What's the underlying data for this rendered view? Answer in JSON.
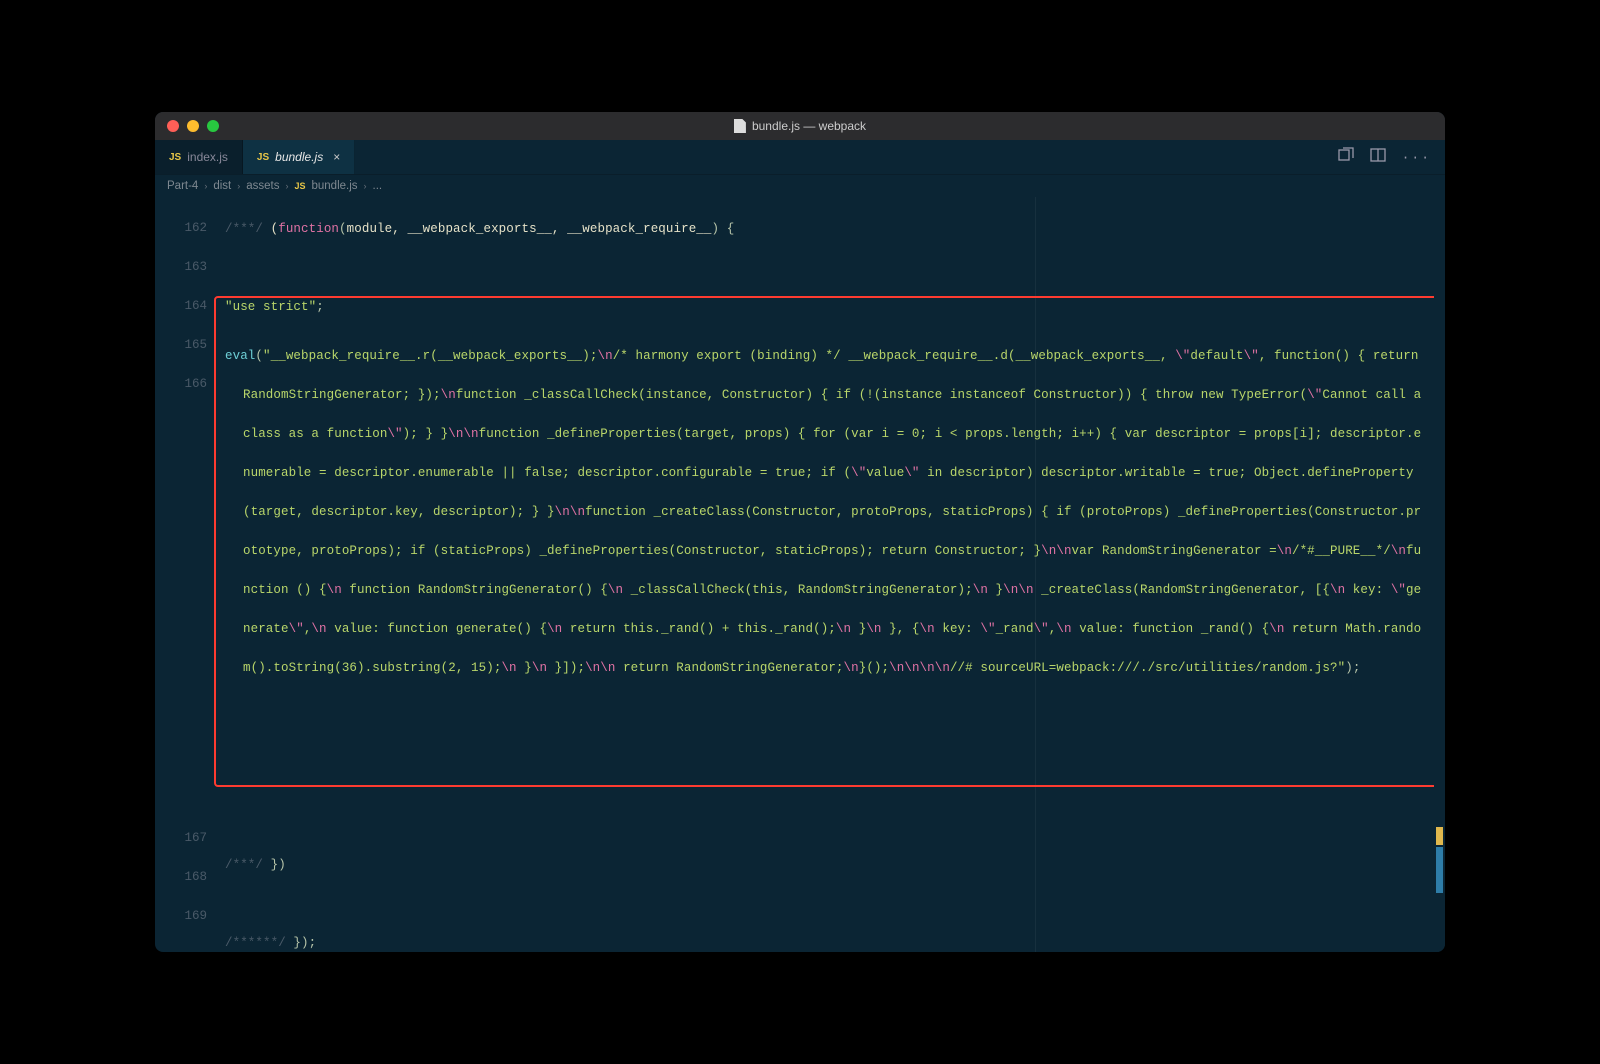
{
  "window": {
    "title": "bundle.js — webpack"
  },
  "tabs": {
    "inactive_label": "index.js",
    "active_label": "bundle.js",
    "js_badge": "JS",
    "close_glyph": "×"
  },
  "breadcrumb": {
    "seg1": "Part-4",
    "seg2": "dist",
    "seg3": "assets",
    "seg4": "bundle.js",
    "seg5": "...",
    "sep": "›"
  },
  "gutter": {
    "l162": "162",
    "l163": "163",
    "l164": "164",
    "l165": "165",
    "l166": "166",
    "l167": "167",
    "l168": "168",
    "l169": "169"
  },
  "line162": {
    "a": "/***/",
    "b": " (",
    "c": "function",
    "d": "(",
    "e": "module, __webpack_exports__, __webpack_require__",
    "f": ") {"
  },
  "line164": {
    "a": "\"use strict\"",
    "b": ";"
  },
  "line165": {
    "a": "eval",
    "b": "(",
    "c0": "\"__webpack_require__.r(__webpack_exports__);",
    "e1": "\\n",
    "c1": "/* harmony export (binding) */ __webpack_require__.d(__webpack_exports__, ",
    "q1": "\\\"",
    "c1b": "default",
    "q2": "\\\"",
    "c1c": ", function() { return RandomStringGenerator; });",
    "e2": "\\n",
    "c2": "function _classCallCheck(instance, Constructor) { if (!(instance instanceof Constructor)) { throw new TypeError(",
    "q3": "\\\"",
    "c2b": "Cannot call a class as a function",
    "q4": "\\\"",
    "c2c": "); } }",
    "e3": "\\n\\n",
    "c3": "function _defineProperties(target, props) { for (var i = 0; i < props.length; i++) { var descriptor = props[i]; descriptor.enumerable = descriptor.enumerable || false; descriptor.configurable = true; if (",
    "q5": "\\\"",
    "c3b": "value",
    "q6": "\\\"",
    "c3c": " in descriptor) descriptor.writable = true; Object.defineProperty(target, descriptor.key, descriptor); } }",
    "e4": "\\n\\n",
    "c4": "function _createClass(Constructor, protoProps, staticProps) { if (protoProps) _defineProperties(Constructor.prototype, protoProps); if (staticProps) _defineProperties(Constructor, staticProps); return Constructor; }",
    "e5": "\\n\\n",
    "c5": "var RandomStringGenerator =",
    "e6": "\\n",
    "c5b": "/*#__PURE__*/",
    "e7": "\\n",
    "c5c": "function () {",
    "e8": "\\n",
    "c6": "  function RandomStringGenerator() {",
    "e9": "\\n",
    "c6b": "    _classCallCheck(this, RandomStringGenerator);",
    "e10": "\\n",
    "c6c": "  }",
    "e11": "\\n\\n",
    "c7": "  _createClass(RandomStringGenerator, [{",
    "e12": "\\n",
    "c7b": "    key: ",
    "q7": "\\\"",
    "c7c": "generate",
    "q8": "\\\"",
    "c7d": ",",
    "e13": "\\n",
    "c8": "    value: function generate() {",
    "e14": "\\n",
    "c8b": "      return this._rand() + this._rand();",
    "e15": "\\n",
    "c8c": "    }",
    "e16": "\\n",
    "c9": "  }, {",
    "e17": "\\n",
    "c9b": "    key: ",
    "q9": "\\\"",
    "c9c": "_rand",
    "q10": "\\\"",
    "c9d": ",",
    "e18": "\\n",
    "c10": "    value: function _rand() {",
    "e19": "\\n",
    "c10b": "      return Math.random().toString(36).substring(2, 15);",
    "e20": "\\n",
    "c10c": "    }",
    "e21": "\\n",
    "c11": "  }]);",
    "e22": "\\n\\n",
    "c12": "  return RandomStringGenerator;",
    "e23": "\\n",
    "c12b": "}();",
    "e24": "\\n\\n\\n\\n",
    "c13": "//# sourceURL=webpack:///./src/utilities/random.js?\"",
    "z": ");"
  },
  "line167": {
    "a": "/***/",
    "b": " })"
  },
  "line169": {
    "a": "/******/",
    "b": " });"
  }
}
